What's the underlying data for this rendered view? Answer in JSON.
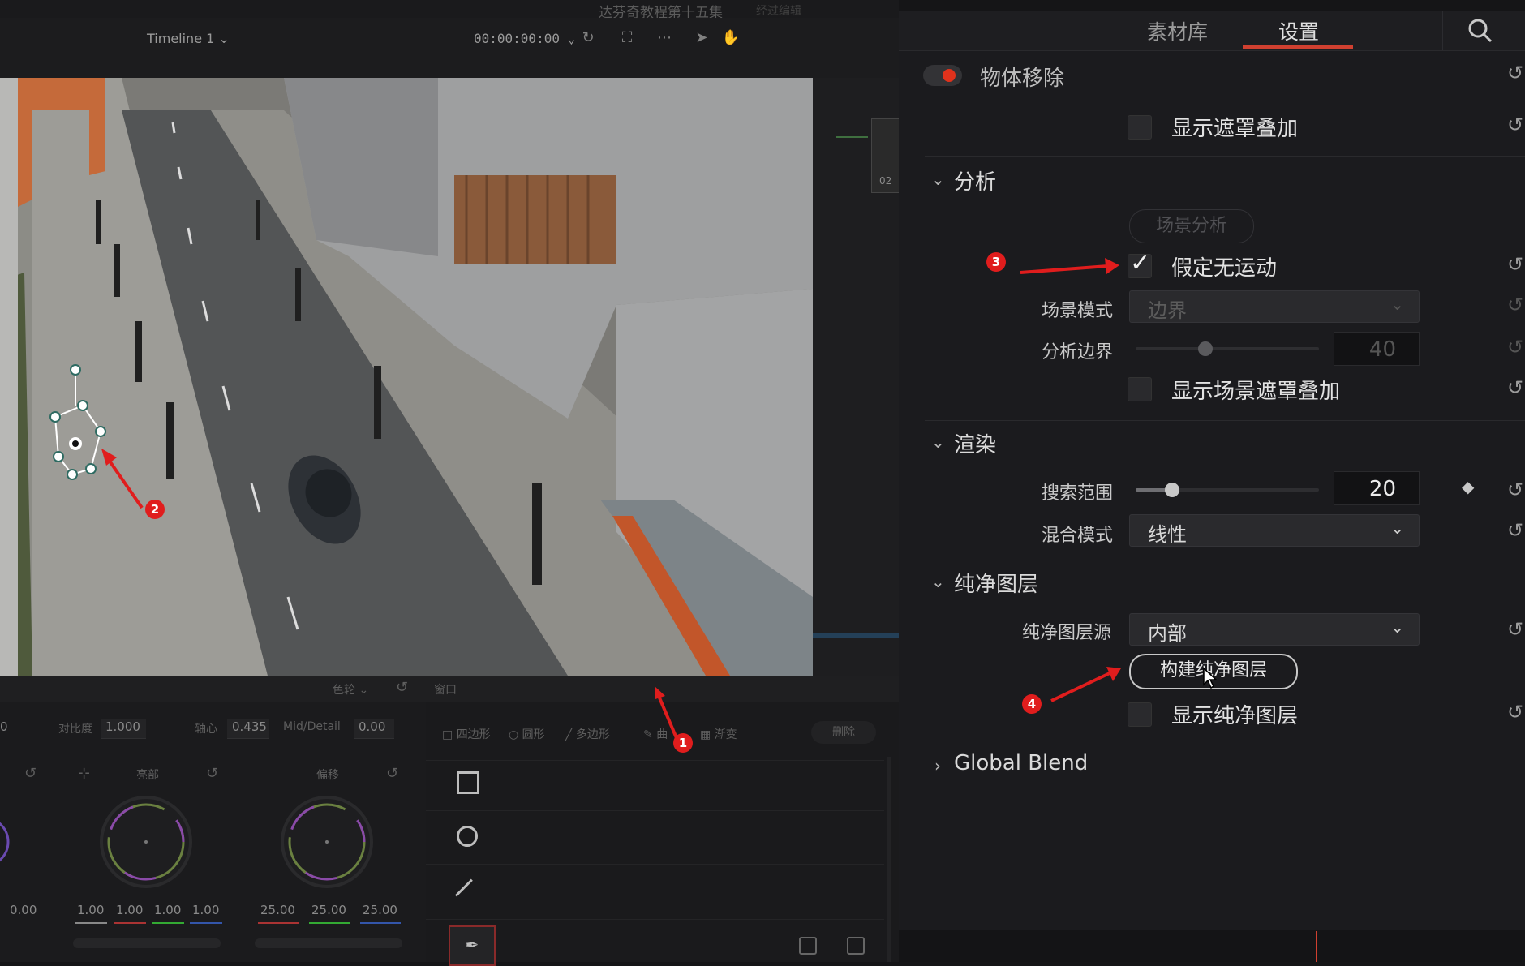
{
  "window": {
    "title": "达芬奇教程第十五集",
    "subtitle": "经过编辑"
  },
  "viewer": {
    "timeline_name": "Timeline 1",
    "timecode": "00:00:00:00",
    "side_badge": "02"
  },
  "panel": {
    "tabs": [
      {
        "label": "素材库",
        "active": false
      },
      {
        "label": "设置",
        "active": true
      }
    ],
    "effect": {
      "label": "物体移除",
      "enabled": true
    },
    "show_mask_overlay": {
      "label": "显示遮罩叠加",
      "checked": false
    },
    "analysis": {
      "title": "分析",
      "scene_analysis_button": "场景分析",
      "assume_no_motion": {
        "label": "假定无运动",
        "checked": true
      },
      "scene_mode": {
        "label": "场景模式",
        "value": "边界"
      },
      "analysis_border": {
        "label": "分析边界",
        "value": "40",
        "fraction": 0.38
      },
      "show_scene_mask_overlay": {
        "label": "显示场景遮罩叠加",
        "checked": false
      }
    },
    "render": {
      "title": "渲染",
      "search_range": {
        "label": "搜索范围",
        "value": "20",
        "fraction": 0.2
      },
      "blend_mode": {
        "label": "混合模式",
        "value": "线性"
      }
    },
    "clean_plate": {
      "title": "纯净图层",
      "source": {
        "label": "纯净图层源",
        "value": "内部"
      },
      "build_button": "构建纯净图层",
      "show_clean_plate": {
        "label": "显示纯净图层",
        "checked": false
      }
    },
    "global_blend": {
      "title": "Global Blend"
    }
  },
  "color": {
    "wheels_mode": "色轮",
    "contrast_label": "对比度",
    "contrast_value": "1.000",
    "pivot_label": "轴心",
    "pivot_value": "0.435",
    "middetail_label": "Mid/Detail",
    "middetail_value": "0.00",
    "edge_value": "0",
    "wheel_labels": [
      "亮部",
      "偏移"
    ],
    "left_value": "0.00",
    "gain_values": [
      "1.00",
      "1.00",
      "1.00",
      "1.00"
    ],
    "offset_values": [
      "25.00",
      "25.00",
      "25.00"
    ]
  },
  "window_panel": {
    "title": "窗口",
    "tools": [
      "四边形",
      "圆形",
      "多边形",
      "曲",
      "渐变"
    ],
    "delete_label": "删除"
  },
  "annotations": [
    "1",
    "2",
    "3",
    "4"
  ],
  "colors": {
    "accent_red": "#d04030",
    "marker_red": "#e01d1d"
  }
}
